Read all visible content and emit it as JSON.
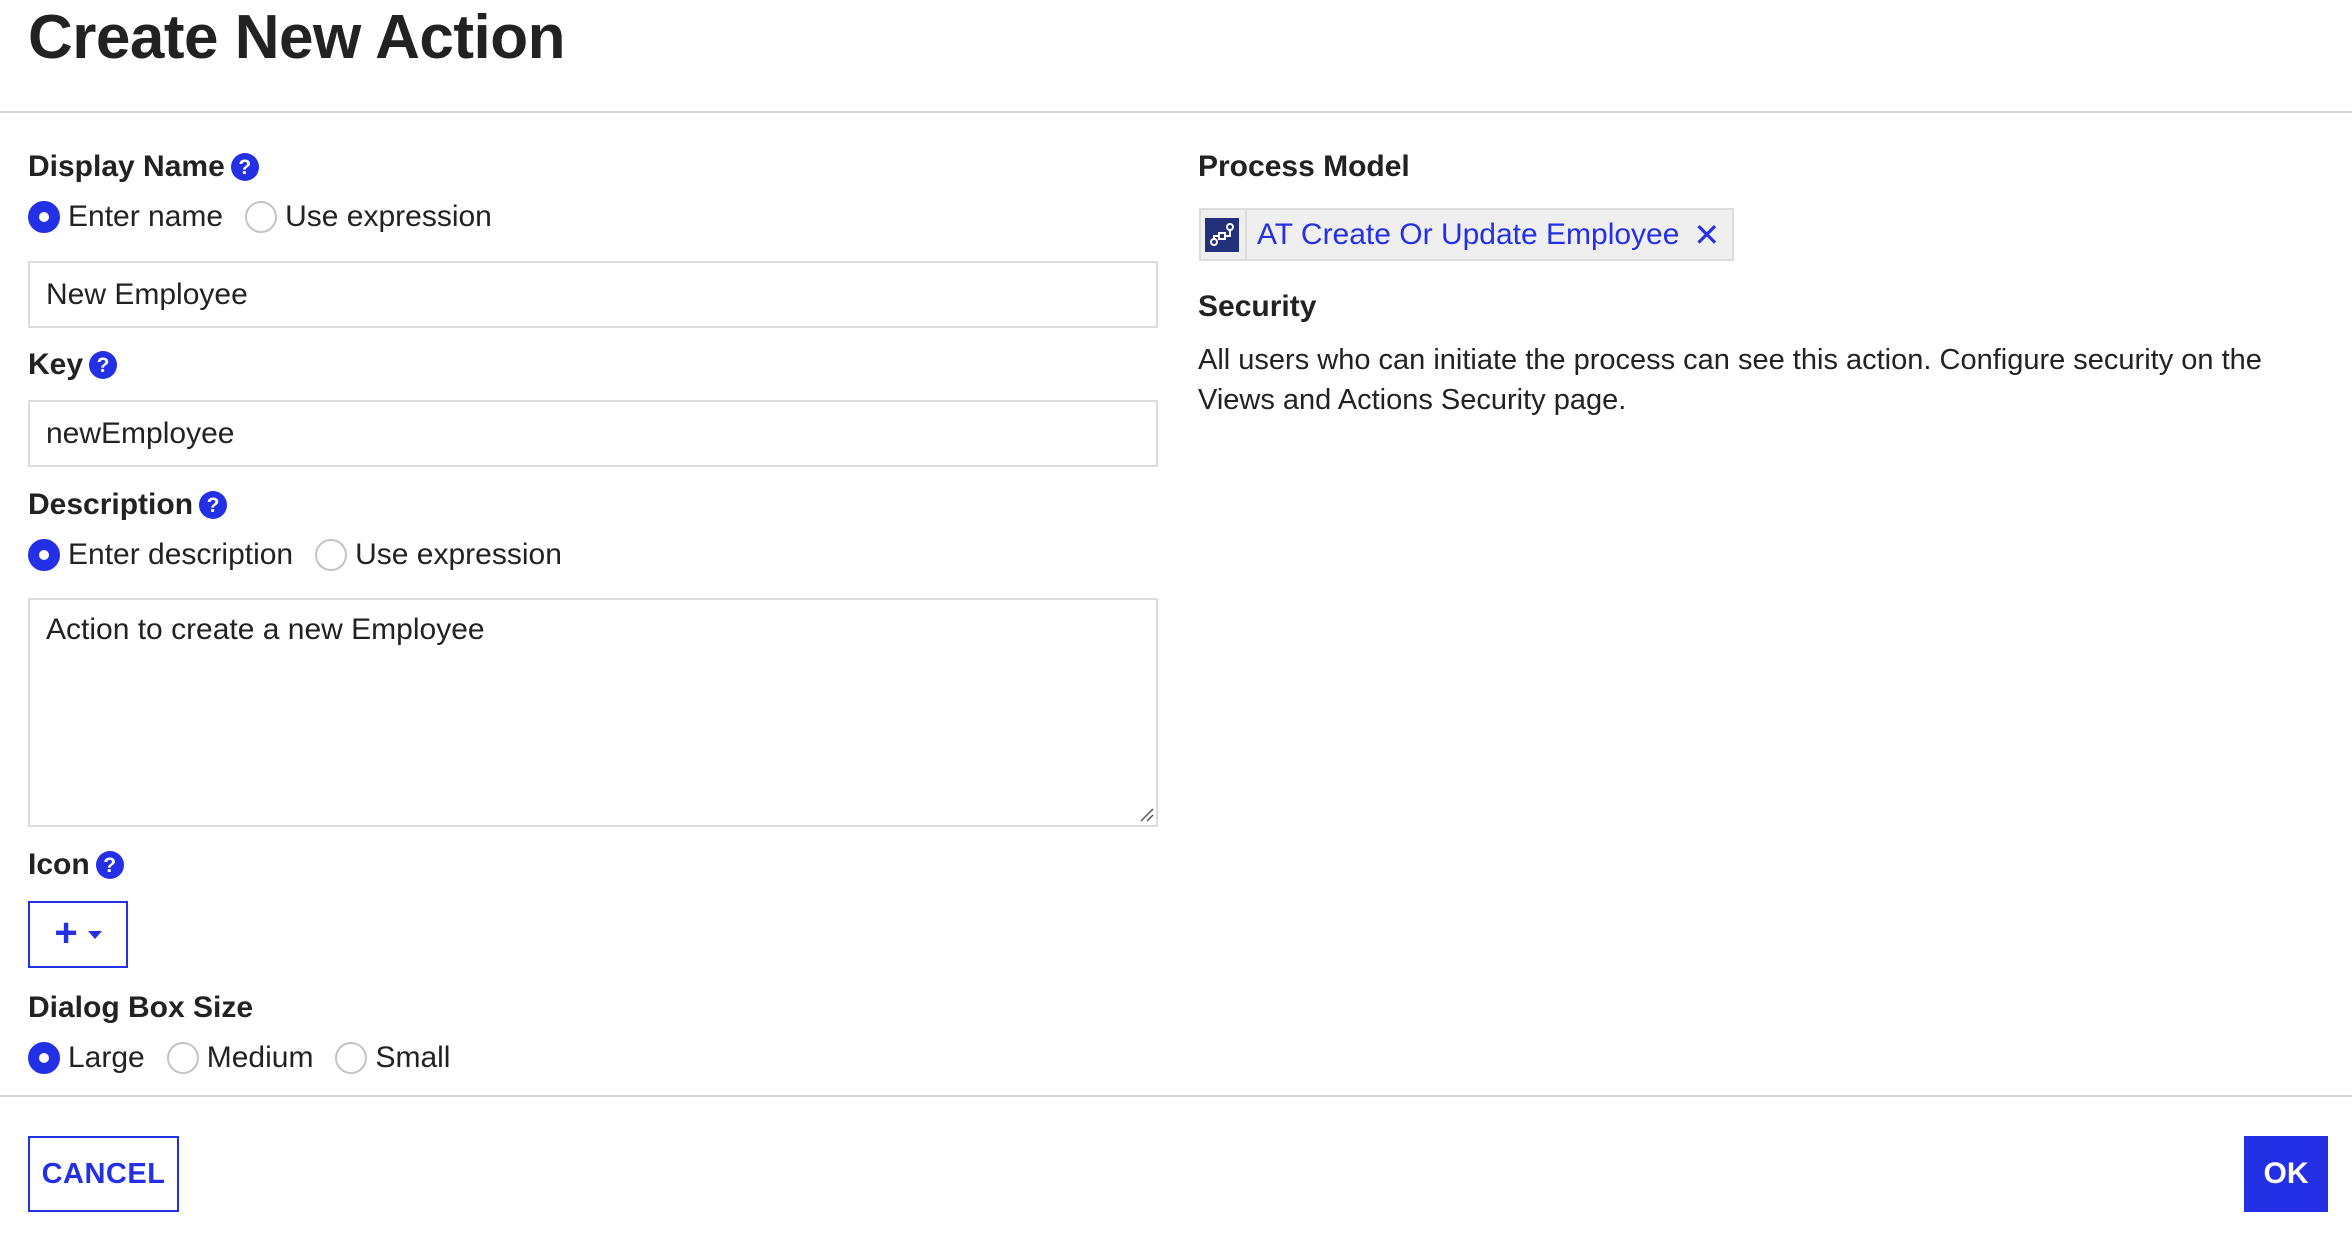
{
  "dialog": {
    "title": "Create New Action"
  },
  "display_name": {
    "label": "Display Name",
    "help_icon": "question-circle-icon",
    "options": [
      {
        "label": "Enter name",
        "checked": true
      },
      {
        "label": "Use expression",
        "checked": false
      }
    ],
    "value": "New Employee"
  },
  "key": {
    "label": "Key",
    "help_icon": "question-circle-icon",
    "value": "newEmployee"
  },
  "description": {
    "label": "Description",
    "help_icon": "question-circle-icon",
    "options": [
      {
        "label": "Enter description",
        "checked": true
      },
      {
        "label": "Use expression",
        "checked": false
      }
    ],
    "value": "Action to create a new Employee"
  },
  "icon": {
    "label": "Icon",
    "help_icon": "question-circle-icon",
    "button_icon": "plus-icon",
    "dropdown_icon": "caret-down-icon"
  },
  "dialog_box_size": {
    "label": "Dialog Box Size",
    "options": [
      {
        "label": "Large",
        "checked": true
      },
      {
        "label": "Medium",
        "checked": false
      },
      {
        "label": "Small",
        "checked": false
      }
    ]
  },
  "process_model": {
    "label": "Process Model",
    "icon": "process-model-icon",
    "selected": "AT Create Or Update Employee",
    "remove_icon": "close-x-icon"
  },
  "security": {
    "label": "Security",
    "text": "All users who can initiate the process can see this action. Configure security on the Views and Actions Security page."
  },
  "footer": {
    "cancel_label": "CANCEL",
    "ok_label": "OK"
  },
  "colors": {
    "accent": "#2330e6",
    "process_icon_bg": "#23307a",
    "border": "#dcdcdc",
    "chip_bg": "#efefef",
    "text": "#222222"
  }
}
